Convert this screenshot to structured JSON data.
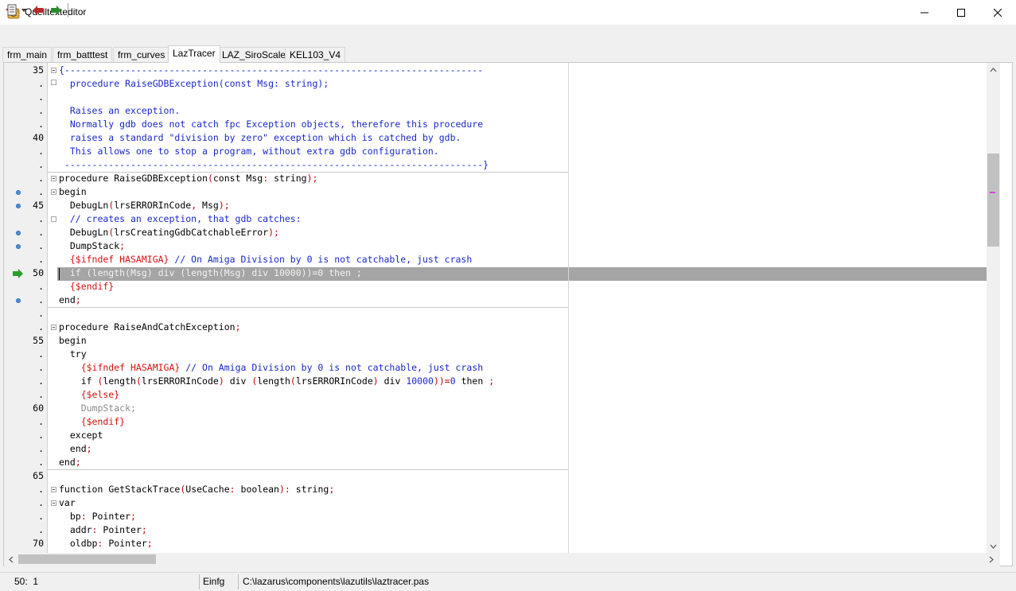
{
  "window": {
    "title": "Quelltexteditor"
  },
  "tabs": [
    "frm_main",
    "frm_batttest",
    "frm_curves",
    "LazTracer",
    "LAZ_SiroScale",
    "KEL103_V4"
  ],
  "active_tab": "LazTracer",
  "gutter": {
    "line_numbers": [
      "35",
      "40",
      "45",
      "50",
      "55",
      "60",
      "65",
      "70"
    ],
    "dot": ".",
    "current_line": "50"
  },
  "code": {
    "l35": "{----------------------------------------------------------------------------",
    "l36": "  procedure RaiseGDBException(const Msg: string);",
    "l38": "  Raises an exception.",
    "l39": "  Normally gdb does not catch fpc Exception objects, therefore this procedure",
    "l40": "  raises a standard \"division by zero\" exception which is catched by gdb.",
    "l41": "  This allows one to stop a program, without extra gdb configuration.",
    "l42": " ----------------------------------------------------------------------------}",
    "l43a": "procedure",
    "l43b": " RaiseGDBException",
    "l43c": "(",
    "l43d": "const",
    "l43e": " Msg",
    "l43f": ":",
    "l43g": " string",
    "l43h": ");",
    "l44": "begin",
    "l45a": "  DebugLn",
    "l45b": "(",
    "l45c": "lrsERRORInCode",
    "l45d": ",",
    "l45e": " Msg",
    "l45f": ");",
    "l46": "  // creates an exception, that gdb catches:",
    "l47a": "  DebugLn",
    "l47b": "(",
    "l47c": "lrsCreatingGdbCatchableError",
    "l47d": ");",
    "l48a": "  DumpStack",
    "l48b": ";",
    "l49a": "  {$ifndef HASAMIGA}",
    "l49b": " // On Amiga Division by 0 is not catchable, just crash",
    "l50": "  if (length(Msg) div (length(Msg) div 10000))=0 then ;",
    "l51": "  {$endif}",
    "l52a": "end",
    "l52b": ";",
    "l54a": "procedure",
    "l54b": " RaiseAndCatchException",
    "l54c": ";",
    "l55": "begin",
    "l56": "  try",
    "l57a": "    {$ifndef HASAMIGA}",
    "l57b": " // On Amiga Division by 0 is not catchable, just crash",
    "l58a": "    if ",
    "l58b": "(",
    "l58c": "length",
    "l58d": "(",
    "l58e": "lrsERRORInCode",
    "l58f": ")",
    "l58g": " div ",
    "l58h": "(",
    "l58i": "length",
    "l58j": "(",
    "l58k": "lrsERRORInCode",
    "l58l": ")",
    "l58m": " div ",
    "l58n": "10000",
    "l58o": "))=",
    "l58p": "0",
    "l58q": " then ",
    "l58r": ";",
    "l59": "    {$else}",
    "l60": "    DumpStack;",
    "l61": "    {$endif}",
    "l62": "  except",
    "l63a": "  end",
    "l63b": ";",
    "l64a": "end",
    "l64b": ";",
    "l66a": "function",
    "l66b": " GetStackTrace",
    "l66c": "(",
    "l66d": "UseCache",
    "l66e": ":",
    "l66f": " boolean",
    "l66g": "):",
    "l66h": " string",
    "l66i": ";",
    "l67": "var",
    "l68a": "  bp",
    "l68b": ":",
    "l68c": " Pointer",
    "l68d": ";",
    "l69a": "  addr",
    "l69b": ":",
    "l69c": " Pointer",
    "l69d": ";",
    "l70a": "  oldbp",
    "l70b": ":",
    "l70c": " Pointer",
    "l70d": ";"
  },
  "status": {
    "position": "50:  1",
    "mode": "Einfg",
    "file": "C:\\lazarus\\components\\lazutils\\laztracer.pas"
  },
  "colors": {
    "comment": "#1a28c8",
    "directive": "#d81010",
    "symbol": "#c00000",
    "exec_line": "#a5a5a5",
    "breakpoint": "#4f8fd6",
    "exec_arrow": "#2e9e2e"
  }
}
